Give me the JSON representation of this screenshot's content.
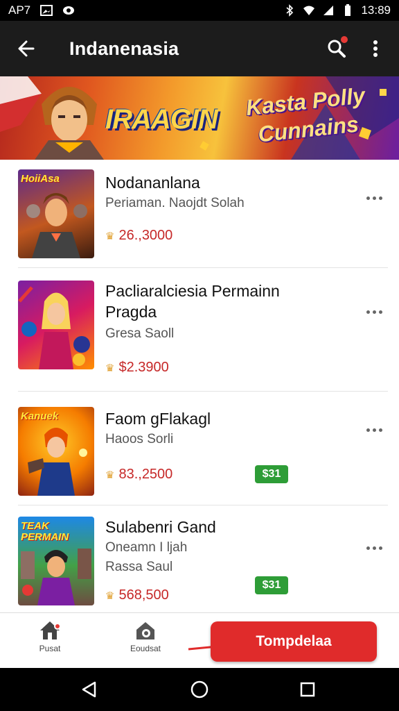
{
  "status_bar": {
    "carrier": "AP7",
    "time": "13:89",
    "icons": [
      "gallery-icon",
      "eye-icon",
      "bluetooth-icon",
      "wifi-icon",
      "signal-icon",
      "battery-icon"
    ]
  },
  "app_bar": {
    "title": "Indanenasia",
    "icons": [
      "back-arrow-icon",
      "search-icon",
      "more-vert-icon"
    ]
  },
  "banner": {
    "logo_text": "IRAAGIN",
    "tagline": "Kasta Polly Cunnains"
  },
  "games": [
    {
      "thumb_label": "HoiiAsa",
      "title": "Nodananlana",
      "subtitle": "Periaman. Naojdt Solah",
      "price": "26.,3000",
      "badge": ""
    },
    {
      "thumb_label": "",
      "title": "Pacliaralciesia Permainn Pragda",
      "subtitle": "Gresa Saoll",
      "price": "$2.3900",
      "badge": ""
    },
    {
      "thumb_label": "Kanuek",
      "title": "Faom gFlakagl",
      "subtitle": "Haoos Sorli",
      "price": "83.,2500",
      "badge": "$31"
    },
    {
      "thumb_label": "TEAK PERMAIN",
      "title": "Sulabenri Gand",
      "subtitle": "Oneamn I ljah",
      "subtitle2": "Rassa Saul",
      "price": "568,500",
      "badge": "$31"
    }
  ],
  "bottom_nav": {
    "home_label": "Pusat",
    "second_label": "Eoudsat",
    "cta_label": "Tompdelaa"
  },
  "colors": {
    "accent": "#e02b2b",
    "price": "#c62828",
    "badge": "#2e9d37",
    "app_bar": "#1c1c1c"
  }
}
